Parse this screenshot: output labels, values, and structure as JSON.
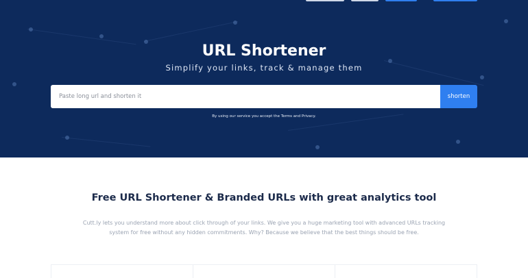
{
  "hero": {
    "title": "URL Shortener",
    "subtitle": "Simplify your links, track & manage them",
    "input_placeholder": "Paste long url and shorten it",
    "shorten_label": "shorten",
    "terms_prefix": "By using our service you accept the ",
    "terms_link": "Terms",
    "terms_and": " and ",
    "privacy_link": "Privacy",
    "terms_suffix": "."
  },
  "features": {
    "title": "Free URL Shortener & Branded URLs with great analytics tool",
    "description": "Cutt.ly lets you understand more about click through of your links. We give you a huge marketing tool with advanced URLs tracking system for free without any hidden commitments. Why? Because we believe that the best things should be free."
  },
  "colors": {
    "hero_bg": "#0d2a5c",
    "accent": "#2f7ff0",
    "title_dark": "#1b2a4a"
  }
}
